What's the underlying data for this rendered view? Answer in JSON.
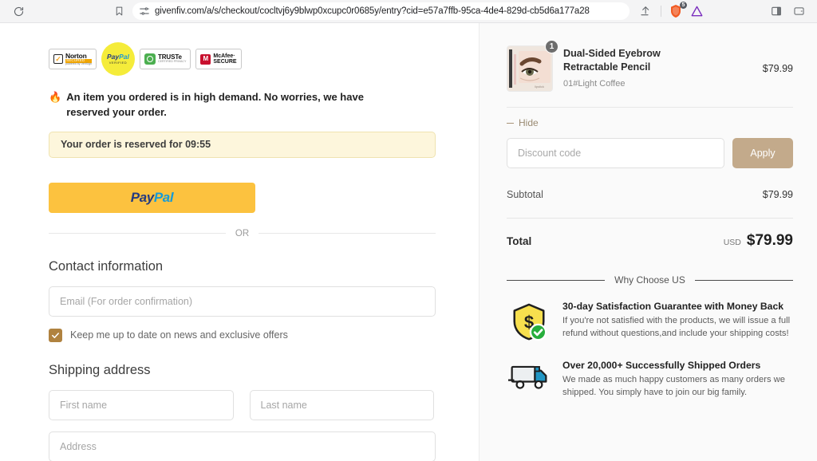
{
  "browser": {
    "url": "givenfiv.com/a/s/checkout/cocltvj6y9blwp0xcupc0r0685y/entry?cid=e57a7ffb-95ca-4de4-829d-cb5d6a177a28",
    "reload_icon": "reload-icon",
    "bookmark_icon": "bookmark-icon",
    "tune_icon": "tune-icon",
    "share_icon": "share-icon",
    "shield_icon": "brave-shield-icon",
    "shield_badge": "5",
    "extension_icon": "triangle-extension-icon",
    "sidepanel_icon": "side-panel-icon",
    "wallet_icon": "wallet-panel-icon"
  },
  "trust_badges": [
    {
      "name": "norton-secured",
      "title": "Norton",
      "subtitle": "SECURED",
      "powered": "powered by VeriSign"
    },
    {
      "name": "paypal-verified",
      "title": "PayPal",
      "subtitle": "VERIFIED"
    },
    {
      "name": "truste-certified",
      "title": "TRUSTe",
      "subtitle": "CERTIFIED PRIVACY"
    },
    {
      "name": "mcafee-secure",
      "line1": "McAfee·",
      "line2": "SECURE"
    }
  ],
  "left": {
    "urgency_emoji": "🔥",
    "urgency_text": "An item you ordered is in high demand. No worries, we have reserved your order.",
    "reserved_text": "Your order is reserved for 09:55",
    "paypal_button": "PayPal",
    "paypal_pay": "Pay",
    "paypal_pal": "Pal",
    "or_text": "OR",
    "contact_heading": "Contact information",
    "email_placeholder": "Email (For order confirmation)",
    "newsletter_label": "Keep me up to date on news and exclusive offers",
    "newsletter_checked": true,
    "shipping_heading": "Shipping address",
    "first_name_placeholder": "First name",
    "last_name_placeholder": "Last name",
    "address_placeholder": "Address",
    "email_value": "",
    "first_name_value": "",
    "last_name_value": "",
    "address_value": ""
  },
  "summary": {
    "product_name": "Dual-Sided Eyebrow Retractable Pencil",
    "product_variant": "01#Light Coffee",
    "product_price": "$79.99",
    "quantity_badge": "1",
    "hide_label": "Hide",
    "discount_placeholder": "Discount code",
    "discount_value": "",
    "apply_label": "Apply",
    "subtotal_label": "Subtotal",
    "subtotal_value": "$79.99",
    "total_label": "Total",
    "total_currency": "USD",
    "total_value": "$79.99"
  },
  "why": {
    "heading": "Why Choose US",
    "features": [
      {
        "icon": "shield-money-icon",
        "title": "30-day Satisfaction Guarantee with Money Back",
        "desc": "If you're not satisfied with the products, we will issue a full refund without questions,and include your shipping costs!"
      },
      {
        "icon": "delivery-truck-icon",
        "title": "Over 20,000+ Successfully Shipped Orders",
        "desc": "We made as much happy customers as many orders we shipped. You simply have to join our big family."
      }
    ]
  },
  "colors": {
    "accent_tan": "#c3aa8b",
    "checkbox": "#b0823f",
    "paypal_yellow": "#fcc23f",
    "reserved_bg": "#fdf6dc"
  }
}
